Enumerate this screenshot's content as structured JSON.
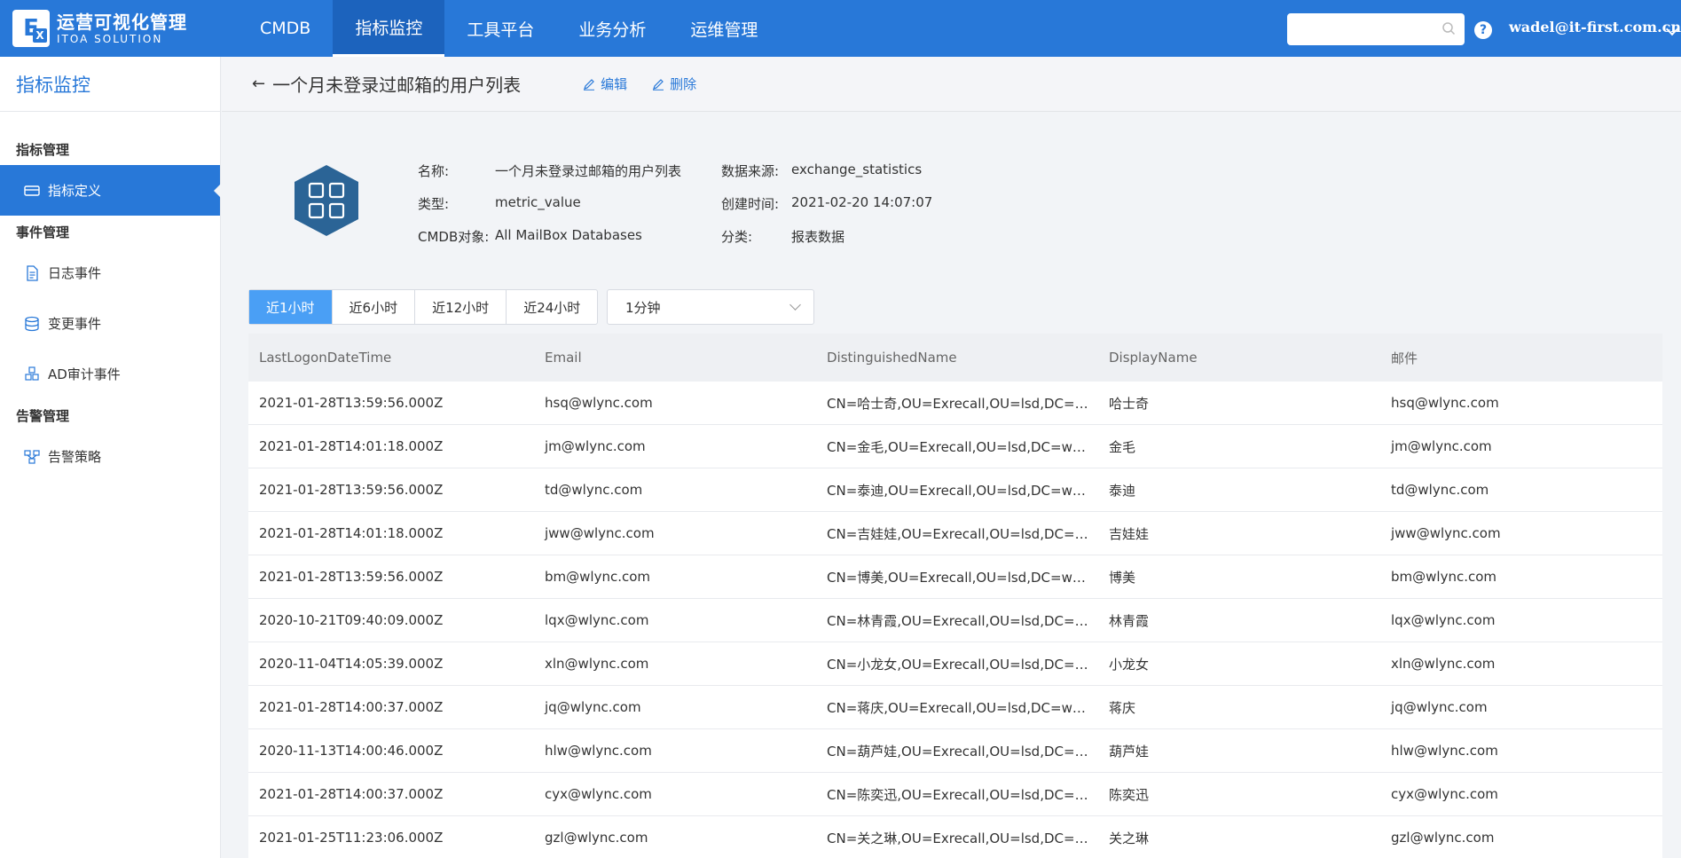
{
  "brand": {
    "logo_letter": "E",
    "logo_sub_letter": "X",
    "name_cn": "运营可视化管理",
    "name_en": "ITOA SOLUTION"
  },
  "nav": {
    "items": [
      {
        "label": "CMDB"
      },
      {
        "label": "指标监控"
      },
      {
        "label": "工具平台"
      },
      {
        "label": "业务分析"
      },
      {
        "label": "运维管理"
      }
    ],
    "active_index": 1
  },
  "header": {
    "search_placeholder": "",
    "help_label": "?",
    "user": "wadel@it-first.com.cn"
  },
  "sidebar": {
    "title": "指标监控",
    "groups": [
      {
        "title": "指标管理",
        "items": [
          {
            "label": "指标定义",
            "icon": "card-icon",
            "active": true
          }
        ]
      },
      {
        "title": "事件管理",
        "items": [
          {
            "label": "日志事件",
            "icon": "document-icon"
          },
          {
            "label": "变更事件",
            "icon": "database-icon"
          },
          {
            "label": "AD审计事件",
            "icon": "cubes-icon"
          }
        ]
      },
      {
        "title": "告警管理",
        "items": [
          {
            "label": "告警策略",
            "icon": "network-icon"
          }
        ]
      }
    ]
  },
  "page": {
    "back_label": "←",
    "title": "一个月未登录过邮箱的用户列表",
    "edit_label": "编辑",
    "delete_label": "删除"
  },
  "info": {
    "name_label": "名称:",
    "name_value": "一个月未登录过邮箱的用户列表",
    "type_label": "类型:",
    "type_value": "metric_value",
    "cmdb_label": "CMDB对象:",
    "cmdb_value": "All MailBox Databases",
    "source_label": "数据来源:",
    "source_value": "exchange_statistics",
    "created_label": "创建时间:",
    "created_value": "2021-02-20 14:07:07",
    "category_label": "分类:",
    "category_value": "报表数据"
  },
  "toolbar": {
    "ranges": [
      "近1小时",
      "近6小时",
      "近12小时",
      "近24小时"
    ],
    "active_range": 0,
    "interval": "1分钟"
  },
  "table": {
    "columns": [
      "LastLogonDateTime",
      "Email",
      "DistinguishedName",
      "DisplayName",
      "邮件"
    ],
    "rows": [
      [
        "2021-01-28T13:59:56.000Z",
        "hsq@wlync.com",
        "CN=哈士奇,OU=Exrecall,OU=lsd,DC=w...",
        "哈士奇",
        "hsq@wlync.com"
      ],
      [
        "2021-01-28T14:01:18.000Z",
        "jm@wlync.com",
        "CN=金毛,OU=Exrecall,OU=lsd,DC=wly...",
        "金毛",
        "jm@wlync.com"
      ],
      [
        "2021-01-28T13:59:56.000Z",
        "td@wlync.com",
        "CN=泰迪,OU=Exrecall,OU=lsd,DC=wly...",
        "泰迪",
        "td@wlync.com"
      ],
      [
        "2021-01-28T14:01:18.000Z",
        "jww@wlync.com",
        "CN=吉娃娃,OU=Exrecall,OU=lsd,DC=w...",
        "吉娃娃",
        "jww@wlync.com"
      ],
      [
        "2021-01-28T13:59:56.000Z",
        "bm@wlync.com",
        "CN=博美,OU=Exrecall,OU=lsd,DC=wly...",
        "博美",
        "bm@wlync.com"
      ],
      [
        "2020-10-21T09:40:09.000Z",
        "lqx@wlync.com",
        "CN=林青霞,OU=Exrecall,OU=lsd,DC=w...",
        "林青霞",
        "lqx@wlync.com"
      ],
      [
        "2020-11-04T14:05:39.000Z",
        "xln@wlync.com",
        "CN=小龙女,OU=Exrecall,OU=lsd,DC=w...",
        "小龙女",
        "xln@wlync.com"
      ],
      [
        "2021-01-28T14:00:37.000Z",
        "jq@wlync.com",
        "CN=蒋庆,OU=Exrecall,OU=lsd,DC=wly...",
        "蒋庆",
        "jq@wlync.com"
      ],
      [
        "2020-11-13T14:00:46.000Z",
        "hlw@wlync.com",
        "CN=葫芦娃,OU=Exrecall,OU=lsd,DC=w...",
        "葫芦娃",
        "hlw@wlync.com"
      ],
      [
        "2021-01-28T14:00:37.000Z",
        "cyx@wlync.com",
        "CN=陈奕迅,OU=Exrecall,OU=lsd,DC=w...",
        "陈奕迅",
        "cyx@wlync.com"
      ],
      [
        "2021-01-25T11:23:06.000Z",
        "gzl@wlync.com",
        "CN=关之琳,OU=Exrecall,OU=lsd,DC=w...",
        "关之琳",
        "gzl@wlync.com"
      ]
    ]
  },
  "colors": {
    "brand_blue": "#2878d8",
    "active_range": "#4a9ff5",
    "hex_icon": "#2b6496"
  }
}
